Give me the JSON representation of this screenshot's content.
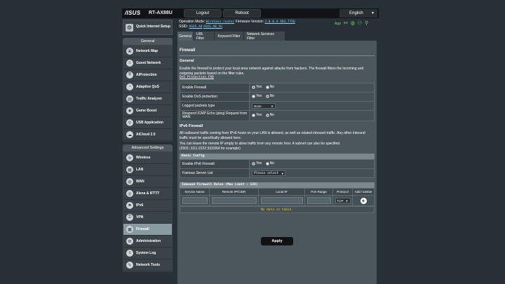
{
  "header": {
    "logo": "/ISUS",
    "model": "RT-AX88U",
    "logout": "Logout",
    "reboot": "Reboot",
    "language": "English"
  },
  "info": {
    "op_mode_label": "Operation Mode:",
    "op_mode_value": "Wireless router",
    "fw_label": "Firmware Version:",
    "fw_value": "3.0.0.4.384_7756",
    "ssid_label": "SSID:",
    "ssid_1": "ASUS_A8",
    "ssid_2": "ASUS_A8_5G",
    "app_label": "App",
    "status_color": "#7ed55a"
  },
  "nav": {
    "quick_setup": "Quick Internet Setup",
    "general_header": "General",
    "general_items": [
      {
        "label": "Network Map",
        "icon": "network-map-icon"
      },
      {
        "label": "Guest Network",
        "icon": "guest-network-icon"
      },
      {
        "label": "AiProtection",
        "icon": "shield-icon"
      },
      {
        "label": "Adaptive QoS",
        "icon": "qos-icon"
      },
      {
        "label": "Traffic Analyzer",
        "icon": "chart-icon"
      },
      {
        "label": "Game Boost",
        "icon": "gamepad-icon"
      },
      {
        "label": "USB Application",
        "icon": "usb-icon"
      },
      {
        "label": "AiCloud 2.0",
        "icon": "cloud-icon"
      }
    ],
    "advanced_header": "Advanced Settings",
    "advanced_items": [
      {
        "label": "Wireless",
        "icon": "wifi-icon"
      },
      {
        "label": "LAN",
        "icon": "lan-icon"
      },
      {
        "label": "WAN",
        "icon": "globe-icon"
      },
      {
        "label": "Alexa & IFTTT",
        "icon": "alexa-icon"
      },
      {
        "label": "IPv6",
        "icon": "ipv6-icon"
      },
      {
        "label": "VPN",
        "icon": "vpn-icon"
      },
      {
        "label": "Firewall",
        "icon": "firewall-icon"
      },
      {
        "label": "Administration",
        "icon": "gear-icon"
      },
      {
        "label": "System Log",
        "icon": "log-icon"
      },
      {
        "label": "Network Tools",
        "icon": "tools-icon"
      }
    ]
  },
  "tabs": [
    "General",
    "URL Filter",
    "Keyword Filter",
    "Network Services Filter"
  ],
  "content": {
    "title": "Firewall",
    "general_heading": "General",
    "general_desc": "Enable the firewall to protect your local area network against attacks from hackers. The firewall filters the incoming and outgoing packets based on the filter rules.",
    "faq_link": "DoS Protection FAQ",
    "rows": {
      "enable_firewall": "Enable Firewall",
      "dos": "Enable DoS protection",
      "logged": "Logged packets type",
      "icmp": "Respond ICMP Echo (ping) Request from WAN"
    },
    "yes": "Yes",
    "no": "No",
    "logged_value": "None",
    "ipv6_heading": "IPv6 Firewall",
    "ipv6_desc1": "All outbound traffic coming from IPv6 hosts on your LAN is allowed, as well as related inbound traffic. Any other inbound traffic must be specifically allowed here.",
    "ipv6_desc2": "You can leave the remote IP empty to allow traffic from any remote host. A subnet can also be specified.",
    "ipv6_desc3": "(2001::1111:2222:3333/64 for example)",
    "basic_config": "Basic Config",
    "enable_ipv6_fw": "Enable IPv6 Firewall",
    "famous_list": "Famous Server List",
    "famous_value": "Please select",
    "rules_header": "Inbound Firewall Rules (Max Limit : 128)",
    "cols": [
      "Service Name",
      "Remote IP/CIDR",
      "Local IP",
      "Port Range",
      "Protocol",
      "Add / Delete"
    ],
    "protocol_value": "TCP",
    "no_data": "No data in table.",
    "apply": "Apply"
  }
}
